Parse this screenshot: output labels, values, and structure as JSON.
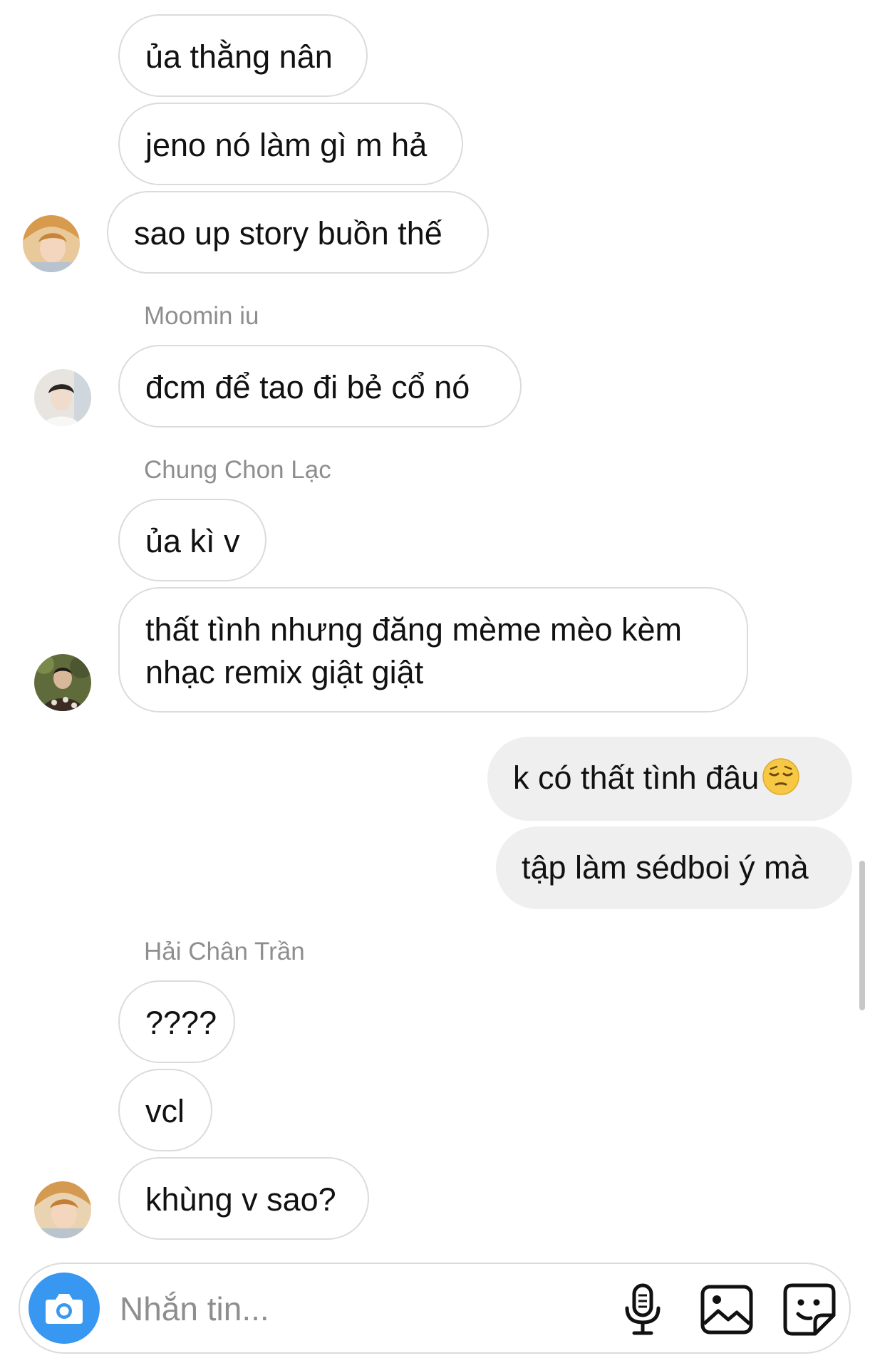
{
  "messages": [
    {
      "text": "ủa thằng nân",
      "from": "other"
    },
    {
      "text": "jeno nó làm gì m hả",
      "from": "other"
    },
    {
      "text": "sao up story buồn thế",
      "from": "other"
    },
    {
      "sender": "Moomin iu"
    },
    {
      "text": "đcm để tao đi bẻ cổ nó",
      "from": "other"
    },
    {
      "sender": "Chung Chon Lạc"
    },
    {
      "text": "ủa kì v",
      "from": "other"
    },
    {
      "text": "thất tình nhưng đăng mème mèo kèm nhạc remix giật giật",
      "from": "other"
    },
    {
      "text": "k có thất tình đâu",
      "from": "me",
      "emoji": "pensive-face"
    },
    {
      "text": "tập làm sédboi ý mà",
      "from": "me"
    },
    {
      "sender": "Hải Chân Trần"
    },
    {
      "text": "????",
      "from": "other"
    },
    {
      "text": "vcl",
      "from": "other"
    },
    {
      "text": "khùng v sao?",
      "from": "other"
    }
  ],
  "composer": {
    "placeholder": "Nhắn tin...",
    "icons": [
      "camera-icon",
      "microphone-icon",
      "gallery-icon",
      "sticker-icon"
    ],
    "accent": "#3897f0"
  },
  "colors": {
    "bubble_border": "#dbdbdb",
    "my_bubble": "#efefef",
    "sender_name": "#8e8e8e"
  }
}
